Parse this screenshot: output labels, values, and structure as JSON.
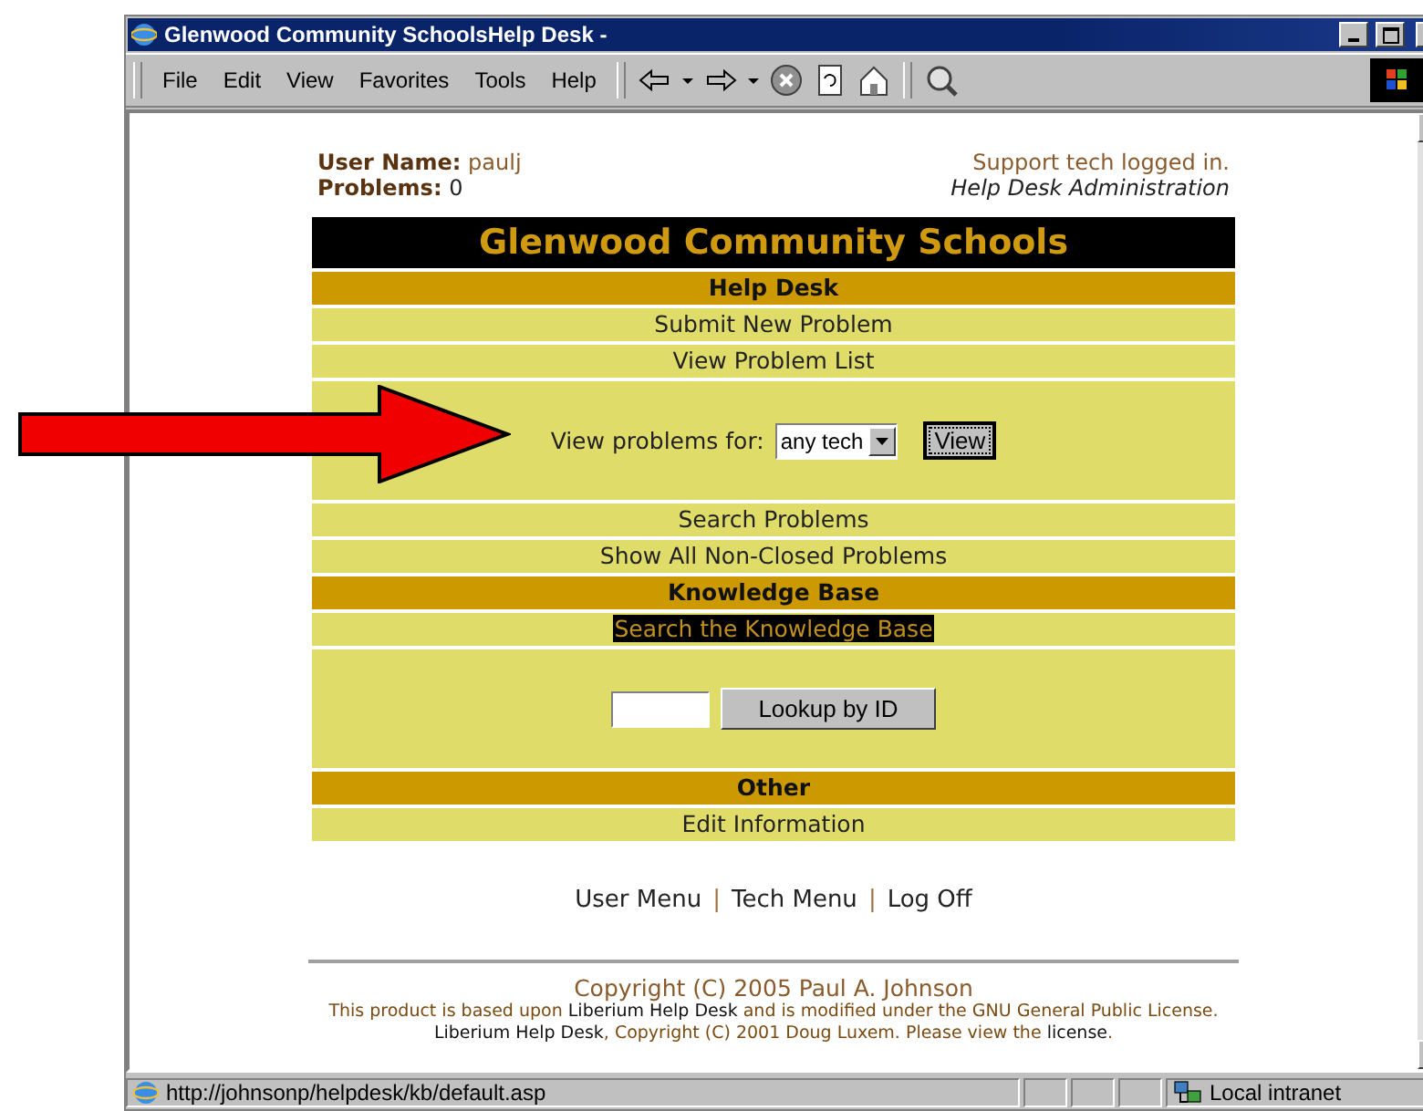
{
  "window": {
    "title": "Glenwood Community SchoolsHelp Desk -"
  },
  "menu": [
    "File",
    "Edit",
    "View",
    "Favorites",
    "Tools",
    "Help"
  ],
  "user_info": {
    "user_name_label": "User Name:",
    "user_name": "paulj",
    "problems_label": "Problems:",
    "problems": "0",
    "status": "Support tech logged in.",
    "role": "Help Desk Administration"
  },
  "banner": "Glenwood Community Schools",
  "rows": [
    {
      "kind": "heading",
      "label": "Help Desk"
    },
    {
      "kind": "link",
      "label": "Submit New Problem"
    },
    {
      "kind": "link",
      "label": "View Problem List"
    },
    {
      "kind": "filter",
      "label": "View problems for:",
      "value": "any tech",
      "button": "View"
    },
    {
      "kind": "link",
      "label": "Search Problems"
    },
    {
      "kind": "link",
      "label": "Show All Non-Closed Problems"
    },
    {
      "kind": "heading",
      "label": "Knowledge Base"
    },
    {
      "kind": "highlight",
      "label": "Search the Knowledge Base"
    },
    {
      "kind": "lookup",
      "button": "Lookup by ID"
    },
    {
      "kind": "heading",
      "label": "Other"
    },
    {
      "kind": "link",
      "label": "Edit Information"
    }
  ],
  "footer_links": {
    "links": [
      "User Menu",
      "Tech Menu",
      "Log Off"
    ],
    "separator": "|"
  },
  "copyright": "Copyright (C) 2005 Paul A. Johnson",
  "credits": [
    [
      {
        "text": "This product is based upon "
      },
      {
        "text": "Liberium Help Desk",
        "link": true
      },
      {
        "text": " and is modified under the GNU General Public License."
      }
    ],
    [
      {
        "text": "Liberium Help Desk",
        "link": true
      },
      {
        "text": ", Copyright (C) 2001 Doug Luxem. Please view the "
      },
      {
        "text": "license",
        "link": true
      },
      {
        "text": "."
      }
    ]
  ],
  "status_bar": {
    "url": "http://johnsonp/helpdesk/kb/default.asp",
    "zone": "Local intranet"
  }
}
